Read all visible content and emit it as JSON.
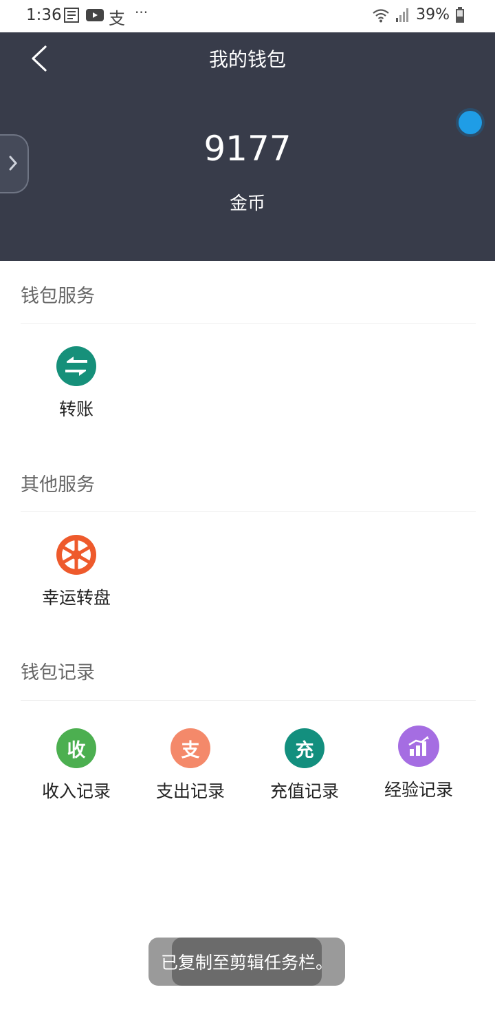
{
  "status_bar": {
    "time": "1:36",
    "left_icons": [
      "news-icon",
      "youtube-icon",
      "alipay-icon",
      "more-dots-icon"
    ],
    "more": "···",
    "battery": "39%"
  },
  "header": {
    "title": "我的钱包",
    "balance": "9177",
    "unit": "金币",
    "background_color": "#383c4a"
  },
  "sections": [
    {
      "title": "钱包服务",
      "items": [
        {
          "label": "转账",
          "icon": "transfer-icon",
          "color": "#16907a"
        }
      ]
    },
    {
      "title": "其他服务",
      "items": [
        {
          "label": "幸运转盘",
          "icon": "lucky-wheel-icon",
          "color": "#ee5a2c"
        }
      ]
    },
    {
      "title": "钱包记录",
      "items": [
        {
          "label": "收入记录",
          "glyph": "收",
          "icon": "income-icon",
          "color": "#4caf50"
        },
        {
          "label": "支出记录",
          "glyph": "支",
          "icon": "expense-icon",
          "color": "#f4896a"
        },
        {
          "label": "充值记录",
          "glyph": "充",
          "icon": "recharge-icon",
          "color": "#138f7e"
        },
        {
          "label": "经验记录",
          "icon": "experience-chart-icon",
          "color": "#a56de2"
        }
      ]
    }
  ],
  "toast": "已复制至剪辑任务栏。"
}
